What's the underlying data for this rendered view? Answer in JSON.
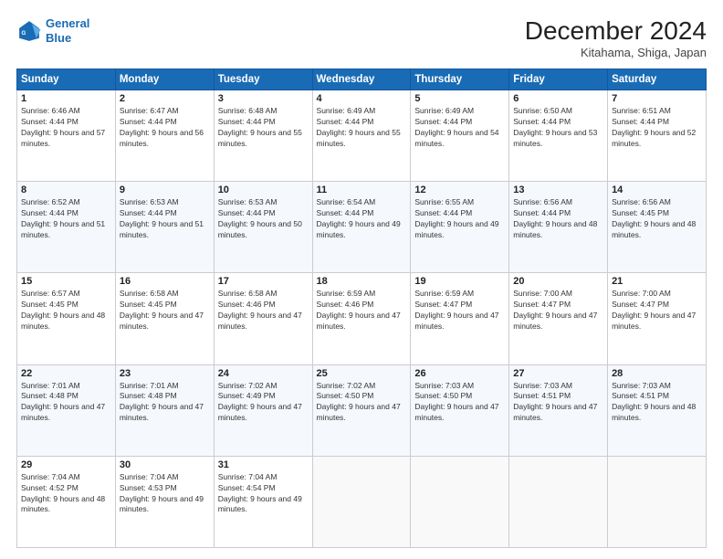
{
  "logo": {
    "line1": "General",
    "line2": "Blue"
  },
  "header": {
    "title": "December 2024",
    "location": "Kitahama, Shiga, Japan"
  },
  "weekdays": [
    "Sunday",
    "Monday",
    "Tuesday",
    "Wednesday",
    "Thursday",
    "Friday",
    "Saturday"
  ],
  "weeks": [
    [
      {
        "day": "1",
        "sunrise": "Sunrise: 6:46 AM",
        "sunset": "Sunset: 4:44 PM",
        "daylight": "Daylight: 9 hours and 57 minutes."
      },
      {
        "day": "2",
        "sunrise": "Sunrise: 6:47 AM",
        "sunset": "Sunset: 4:44 PM",
        "daylight": "Daylight: 9 hours and 56 minutes."
      },
      {
        "day": "3",
        "sunrise": "Sunrise: 6:48 AM",
        "sunset": "Sunset: 4:44 PM",
        "daylight": "Daylight: 9 hours and 55 minutes."
      },
      {
        "day": "4",
        "sunrise": "Sunrise: 6:49 AM",
        "sunset": "Sunset: 4:44 PM",
        "daylight": "Daylight: 9 hours and 55 minutes."
      },
      {
        "day": "5",
        "sunrise": "Sunrise: 6:49 AM",
        "sunset": "Sunset: 4:44 PM",
        "daylight": "Daylight: 9 hours and 54 minutes."
      },
      {
        "day": "6",
        "sunrise": "Sunrise: 6:50 AM",
        "sunset": "Sunset: 4:44 PM",
        "daylight": "Daylight: 9 hours and 53 minutes."
      },
      {
        "day": "7",
        "sunrise": "Sunrise: 6:51 AM",
        "sunset": "Sunset: 4:44 PM",
        "daylight": "Daylight: 9 hours and 52 minutes."
      }
    ],
    [
      {
        "day": "8",
        "sunrise": "Sunrise: 6:52 AM",
        "sunset": "Sunset: 4:44 PM",
        "daylight": "Daylight: 9 hours and 51 minutes."
      },
      {
        "day": "9",
        "sunrise": "Sunrise: 6:53 AM",
        "sunset": "Sunset: 4:44 PM",
        "daylight": "Daylight: 9 hours and 51 minutes."
      },
      {
        "day": "10",
        "sunrise": "Sunrise: 6:53 AM",
        "sunset": "Sunset: 4:44 PM",
        "daylight": "Daylight: 9 hours and 50 minutes."
      },
      {
        "day": "11",
        "sunrise": "Sunrise: 6:54 AM",
        "sunset": "Sunset: 4:44 PM",
        "daylight": "Daylight: 9 hours and 49 minutes."
      },
      {
        "day": "12",
        "sunrise": "Sunrise: 6:55 AM",
        "sunset": "Sunset: 4:44 PM",
        "daylight": "Daylight: 9 hours and 49 minutes."
      },
      {
        "day": "13",
        "sunrise": "Sunrise: 6:56 AM",
        "sunset": "Sunset: 4:44 PM",
        "daylight": "Daylight: 9 hours and 48 minutes."
      },
      {
        "day": "14",
        "sunrise": "Sunrise: 6:56 AM",
        "sunset": "Sunset: 4:45 PM",
        "daylight": "Daylight: 9 hours and 48 minutes."
      }
    ],
    [
      {
        "day": "15",
        "sunrise": "Sunrise: 6:57 AM",
        "sunset": "Sunset: 4:45 PM",
        "daylight": "Daylight: 9 hours and 48 minutes."
      },
      {
        "day": "16",
        "sunrise": "Sunrise: 6:58 AM",
        "sunset": "Sunset: 4:45 PM",
        "daylight": "Daylight: 9 hours and 47 minutes."
      },
      {
        "day": "17",
        "sunrise": "Sunrise: 6:58 AM",
        "sunset": "Sunset: 4:46 PM",
        "daylight": "Daylight: 9 hours and 47 minutes."
      },
      {
        "day": "18",
        "sunrise": "Sunrise: 6:59 AM",
        "sunset": "Sunset: 4:46 PM",
        "daylight": "Daylight: 9 hours and 47 minutes."
      },
      {
        "day": "19",
        "sunrise": "Sunrise: 6:59 AM",
        "sunset": "Sunset: 4:47 PM",
        "daylight": "Daylight: 9 hours and 47 minutes."
      },
      {
        "day": "20",
        "sunrise": "Sunrise: 7:00 AM",
        "sunset": "Sunset: 4:47 PM",
        "daylight": "Daylight: 9 hours and 47 minutes."
      },
      {
        "day": "21",
        "sunrise": "Sunrise: 7:00 AM",
        "sunset": "Sunset: 4:47 PM",
        "daylight": "Daylight: 9 hours and 47 minutes."
      }
    ],
    [
      {
        "day": "22",
        "sunrise": "Sunrise: 7:01 AM",
        "sunset": "Sunset: 4:48 PM",
        "daylight": "Daylight: 9 hours and 47 minutes."
      },
      {
        "day": "23",
        "sunrise": "Sunrise: 7:01 AM",
        "sunset": "Sunset: 4:48 PM",
        "daylight": "Daylight: 9 hours and 47 minutes."
      },
      {
        "day": "24",
        "sunrise": "Sunrise: 7:02 AM",
        "sunset": "Sunset: 4:49 PM",
        "daylight": "Daylight: 9 hours and 47 minutes."
      },
      {
        "day": "25",
        "sunrise": "Sunrise: 7:02 AM",
        "sunset": "Sunset: 4:50 PM",
        "daylight": "Daylight: 9 hours and 47 minutes."
      },
      {
        "day": "26",
        "sunrise": "Sunrise: 7:03 AM",
        "sunset": "Sunset: 4:50 PM",
        "daylight": "Daylight: 9 hours and 47 minutes."
      },
      {
        "day": "27",
        "sunrise": "Sunrise: 7:03 AM",
        "sunset": "Sunset: 4:51 PM",
        "daylight": "Daylight: 9 hours and 47 minutes."
      },
      {
        "day": "28",
        "sunrise": "Sunrise: 7:03 AM",
        "sunset": "Sunset: 4:51 PM",
        "daylight": "Daylight: 9 hours and 48 minutes."
      }
    ],
    [
      {
        "day": "29",
        "sunrise": "Sunrise: 7:04 AM",
        "sunset": "Sunset: 4:52 PM",
        "daylight": "Daylight: 9 hours and 48 minutes."
      },
      {
        "day": "30",
        "sunrise": "Sunrise: 7:04 AM",
        "sunset": "Sunset: 4:53 PM",
        "daylight": "Daylight: 9 hours and 49 minutes."
      },
      {
        "day": "31",
        "sunrise": "Sunrise: 7:04 AM",
        "sunset": "Sunset: 4:54 PM",
        "daylight": "Daylight: 9 hours and 49 minutes."
      },
      null,
      null,
      null,
      null
    ]
  ]
}
